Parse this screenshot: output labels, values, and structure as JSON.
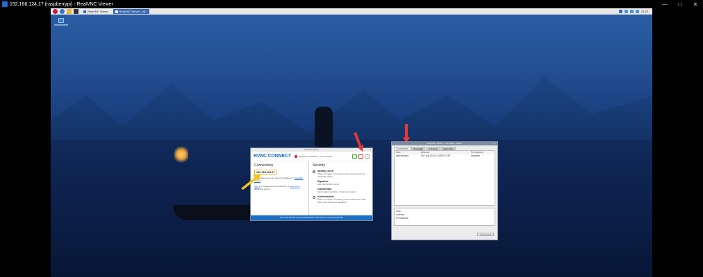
{
  "viewer": {
    "title": "192.168.124.17 (raspberrypi) - RealVNC Viewer"
  },
  "taskbar": {
    "tasks": [
      {
        "label": "RealVNC Server"
      },
      {
        "label": "RealVNC Server - Inf..."
      }
    ],
    "clock": "21:22"
  },
  "desktop": {
    "icon_label": "Wastebasket"
  },
  "vnc_server": {
    "window_title": "RealVNC Server",
    "logo": "RVNC CONNECT",
    "device": "Raspberry Pi Edition - Service Mode",
    "connectivity": {
      "heading": "Connectivity",
      "ip": "192.168.124.17",
      "note_line1": "Connecting users can enter this address in",
      "viewer_link": "RealVNC Viewer",
      "signin_link": "Sign in",
      "signin_rest": "to enable cloud connectivity or",
      "learn_link": "learn more",
      "learn_rest": "about this service"
    },
    "security": {
      "heading": "Security",
      "items": [
        {
          "title": "Identity check",
          "desc": "When prompted, connecting users should check for matching values"
        },
        {
          "title": "Signature",
          "desc": "af:e7:4b:9b:40:1f:12:32"
        },
        {
          "title": "Catchphrase",
          "desc": "Falcon grand ambition. Voltan nato grand"
        },
        {
          "title": "Authentication",
          "desc": "When prompted, connecting users should enter their UNIX user name and password"
        }
      ]
    },
    "footer": "Non-commercial use only. Download VNC Server and get connected"
  },
  "info_center": {
    "window_title": "RealVNC Server - Information Center",
    "tabs": [
      "Connections",
      "Messages",
      "Licensing",
      "Diagnostics"
    ],
    "columns": [
      "User",
      "Address",
      "Permissions"
    ],
    "rows": [
      {
        "user": "administrator",
        "address": "192.168.124.14::62360 (TCP)",
        "permissions": "Standard"
      }
    ],
    "detail_labels": [
      "User:",
      "Address:",
      "Permissions:"
    ],
    "disconnect_label": "Disconnect"
  }
}
